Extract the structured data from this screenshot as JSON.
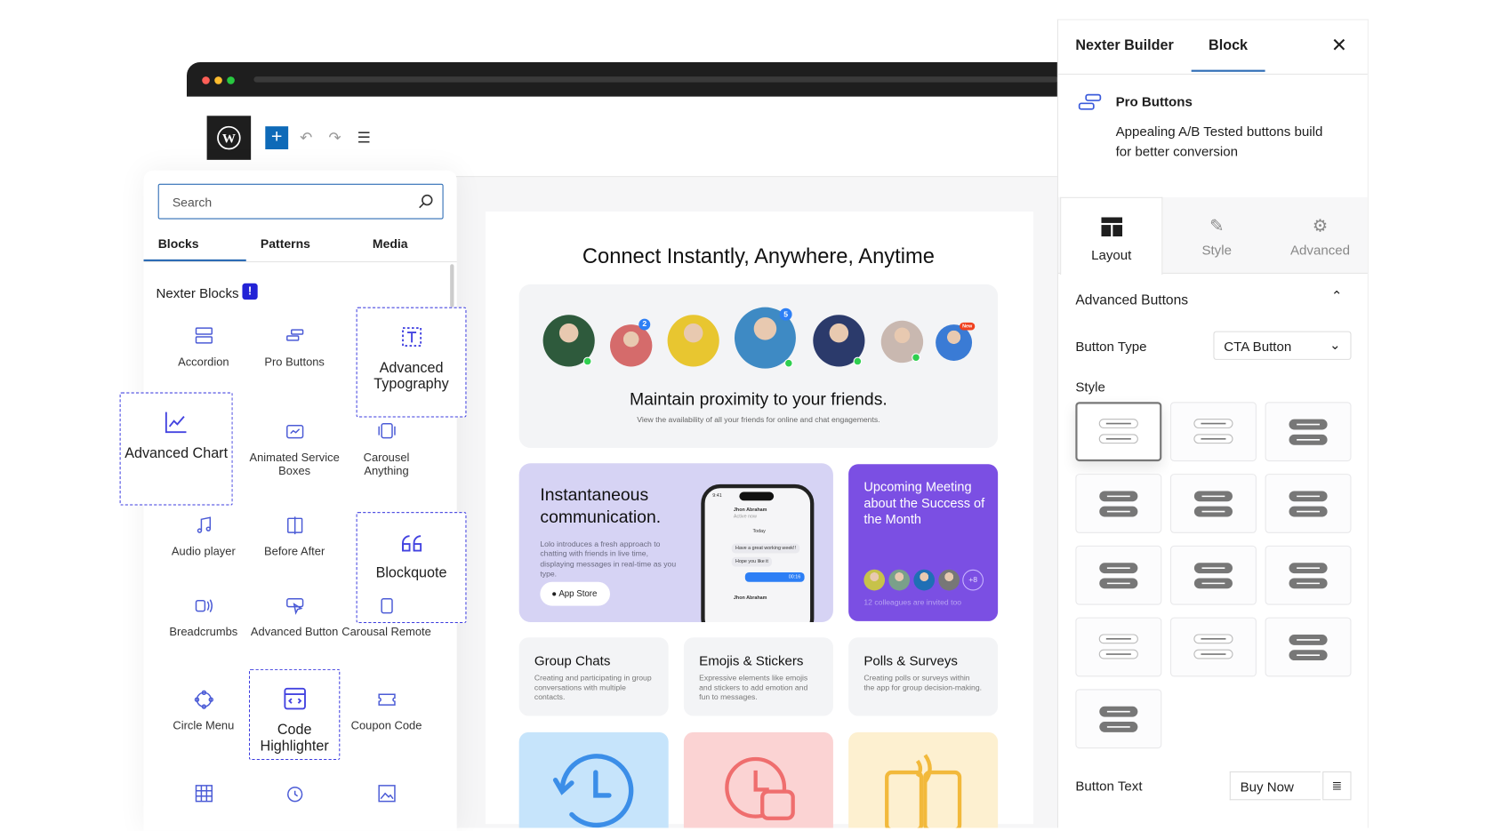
{
  "editor": {
    "toolbar": {
      "add_label": "+",
      "undo_icon": "undo-icon",
      "redo_icon": "redo-icon",
      "list_icon": "list-view-icon"
    }
  },
  "inserter": {
    "search_placeholder": "Search",
    "tabs": [
      "Blocks",
      "Patterns",
      "Media"
    ],
    "active_tab": "Blocks",
    "section_title": "Nexter Blocks",
    "section_badge": "!",
    "blocks": [
      {
        "label": "Accordion",
        "icon": "accordion-icon"
      },
      {
        "label": "Pro Buttons",
        "icon": "pro-buttons-icon"
      },
      {
        "label": "Advanced Typography",
        "icon": "typography-icon",
        "highlighted": true
      },
      {
        "label": "Advanced Chart",
        "icon": "chart-icon",
        "highlighted": true
      },
      {
        "label": "Animated Service Boxes",
        "icon": "service-box-icon"
      },
      {
        "label": "Carousel Anything",
        "icon": "carousel-icon"
      },
      {
        "label": "Audio player",
        "icon": "music-note-icon"
      },
      {
        "label": "Before After",
        "icon": "before-after-icon"
      },
      {
        "label": "Blockquote",
        "icon": "quote-icon",
        "highlighted": true
      },
      {
        "label": "Breadcrumbs",
        "icon": "breadcrumbs-icon"
      },
      {
        "label": "Advanced Button",
        "icon": "button-cursor-icon"
      },
      {
        "label": "Carousal Remote",
        "icon": "carousel-remote-icon"
      },
      {
        "label": "Circle Menu",
        "icon": "circle-menu-icon"
      },
      {
        "label": "Code Highlighter",
        "icon": "code-icon",
        "highlighted": true
      },
      {
        "label": "Coupon Code",
        "icon": "coupon-icon"
      },
      {
        "label": "",
        "icon": "table-icon"
      },
      {
        "label": "",
        "icon": "clock-icon"
      },
      {
        "label": "",
        "icon": "image-icon"
      }
    ]
  },
  "page": {
    "title": "Connect Instantly, Anywhere, Anytime",
    "hero": {
      "heading": "Maintain proximity to your friends.",
      "subtext": "View the availability of all your friends for online and chat engagements.",
      "badges": [
        "2",
        "5",
        "New"
      ]
    },
    "comm": {
      "heading": "Instantaneous communication.",
      "text": "Lolo introduces a fresh approach to chatting with friends in live time, displaying messages in real-time as you type.",
      "button": "App Store",
      "phone": {
        "time": "9:41",
        "contact": "Jhon Abraham",
        "status": "Active now",
        "day": "Today",
        "msg1": "Have a great working week!!",
        "msg2": "Hope you like it",
        "voice_time": "00:16"
      }
    },
    "meeting": {
      "heading": "Upcoming Meeting about the Success of the Month",
      "more": "+8",
      "note": "12 colleagues are invited too"
    },
    "features": [
      {
        "title": "Group Chats",
        "desc": "Creating and participating in group conversations with multiple contacts."
      },
      {
        "title": "Emojis & Stickers",
        "desc": "Expressive elements like emojis and stickers to add emotion and fun to messages."
      },
      {
        "title": "Polls & Surveys",
        "desc": "Creating polls or surveys within the app for group decision-making."
      }
    ],
    "colors": {
      "purple": "#7b4fe3",
      "lavender": "#d6d3f4",
      "blue": "#c6e4fb",
      "pink": "#fbd3d3",
      "yellow": "#fdf0d0"
    }
  },
  "settings": {
    "tabs": [
      "Nexter Builder",
      "Block"
    ],
    "active_tab": "Block",
    "block_name": "Pro Buttons",
    "block_desc": "Appealing A/B Tested buttons build for better conversion",
    "sub_tabs": [
      "Layout",
      "Style",
      "Advanced"
    ],
    "active_sub_tab": "Layout",
    "section": "Advanced Buttons",
    "button_type_label": "Button Type",
    "button_type_value": "CTA Button",
    "style_label": "Style",
    "style_count": 13,
    "selected_style": 1,
    "button_text_label": "Button Text",
    "button_text_value": "Buy Now"
  }
}
